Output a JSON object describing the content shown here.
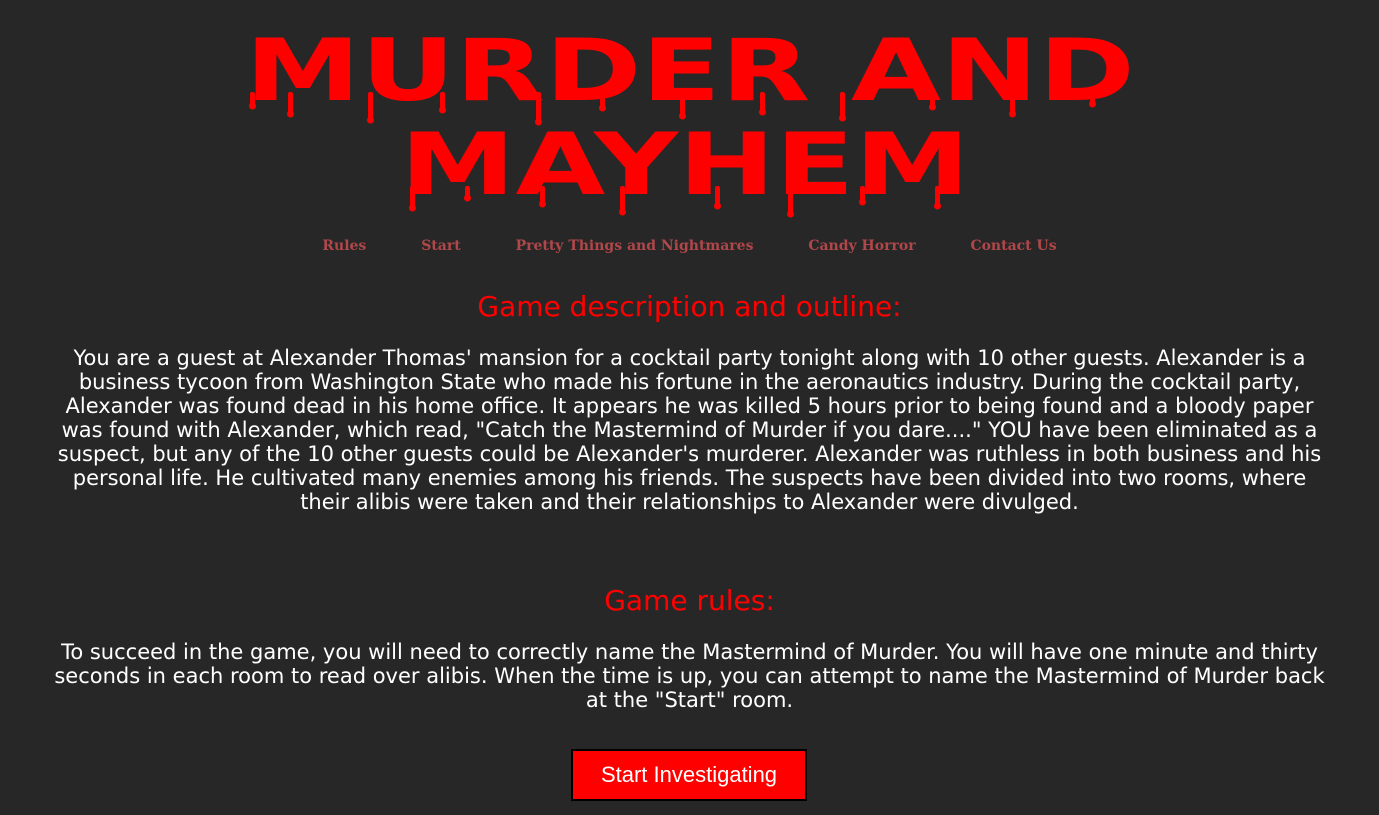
{
  "logo": {
    "line1": "MURDER AND",
    "line2": "MAYHEM",
    "color": "#ff0000"
  },
  "nav": {
    "items": [
      {
        "label": "Rules"
      },
      {
        "label": "Start"
      },
      {
        "label": "Pretty Things and Nightmares"
      },
      {
        "label": "Candy Horror"
      },
      {
        "label": "Contact Us"
      }
    ]
  },
  "description": {
    "heading": "Game description and outline:",
    "text": "You are a guest at Alexander Thomas' mansion for a cocktail party tonight along with 10 other guests. Alexander is a business tycoon from Washington State who made his fortune in the aeronautics industry. During the cocktail party, Alexander was found dead in his home office. It appears he was killed 5 hours prior to being found and a bloody paper was found with Alexander, which read, \"Catch the Mastermind of Murder if you dare....\" YOU have been eliminated as a suspect, but any of the 10 other guests could be Alexander's murderer. Alexander was ruthless in both business and his personal life. He cultivated many enemies among his friends. The suspects have been divided into two rooms, where their alibis were taken and their relationships to Alexander were divulged."
  },
  "rules": {
    "heading": "Game rules:",
    "text": "To succeed in the game, you will need to correctly name the Mastermind of Murder. You will have one minute and thirty seconds in each room to read over alibis. When the time is up, you can attempt to name the Mastermind of Murder back at the \"Start\" room."
  },
  "start_button": {
    "label": "Start Investigating"
  },
  "colors": {
    "background": "#282727",
    "accent": "#ff0000",
    "nav_link": "#b0474a",
    "text": "#ffffff"
  }
}
